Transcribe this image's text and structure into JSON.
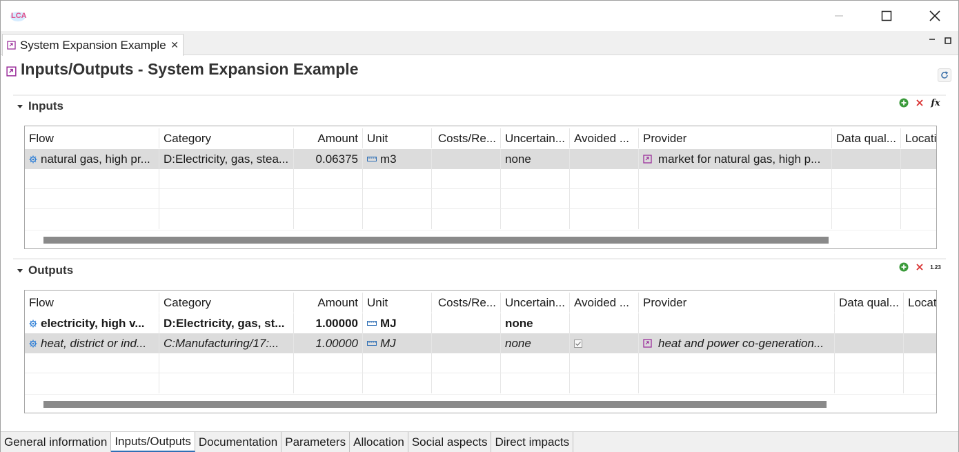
{
  "app": {
    "logo_text": "LCA"
  },
  "editor_tab": {
    "label": "System Expansion Example",
    "close": "✕"
  },
  "page": {
    "title": "Inputs/Outputs - System Expansion Example"
  },
  "inputs": {
    "title": "Inputs",
    "columns": [
      "Flow",
      "Category",
      "Amount",
      "Unit",
      "Costs/Re...",
      "Uncertain...",
      "Avoided ...",
      "Provider",
      "Data qual...",
      "Locati"
    ],
    "rows": [
      {
        "flow": "natural gas, high pr...",
        "category": "D:Electricity, gas, stea...",
        "amount": "0.06375",
        "unit": "m3",
        "costs": "",
        "uncertainty": "none",
        "avoided": false,
        "provider": "market for natural gas, high p...",
        "data_quality": "",
        "location": ""
      }
    ]
  },
  "outputs": {
    "title": "Outputs",
    "columns": [
      "Flow",
      "Category",
      "Amount",
      "Unit",
      "Costs/Re...",
      "Uncertain...",
      "Avoided ...",
      "Provider",
      "Data qual...",
      "Locat"
    ],
    "rows": [
      {
        "flow": "electricity, high v...",
        "category": "D:Electricity, gas, st...",
        "amount": "1.00000",
        "unit": "MJ",
        "costs": "",
        "uncertainty": "none",
        "avoided": false,
        "provider": "",
        "data_quality": "",
        "location": "",
        "style": "bold"
      },
      {
        "flow": "heat, district or ind...",
        "category": "C:Manufacturing/17:...",
        "amount": "1.00000",
        "unit": "MJ",
        "costs": "",
        "uncertainty": "none",
        "avoided": true,
        "provider": "heat and power co-generation...",
        "data_quality": "",
        "location": "",
        "style": "italic"
      }
    ]
  },
  "bottom_tabs": [
    "General information",
    "Inputs/Outputs",
    "Documentation",
    "Parameters",
    "Allocation",
    "Social aspects",
    "Direct impacts"
  ],
  "active_tab": "Inputs/Outputs",
  "colors": {
    "add": "#3a9a3a",
    "remove": "#d93030",
    "process_icon": "#9b2f9b",
    "flow_icon": "#2f7fd6",
    "selected_row": "#dcdcdc"
  },
  "tools": {
    "formula": "fx",
    "numbers": "1.23"
  }
}
